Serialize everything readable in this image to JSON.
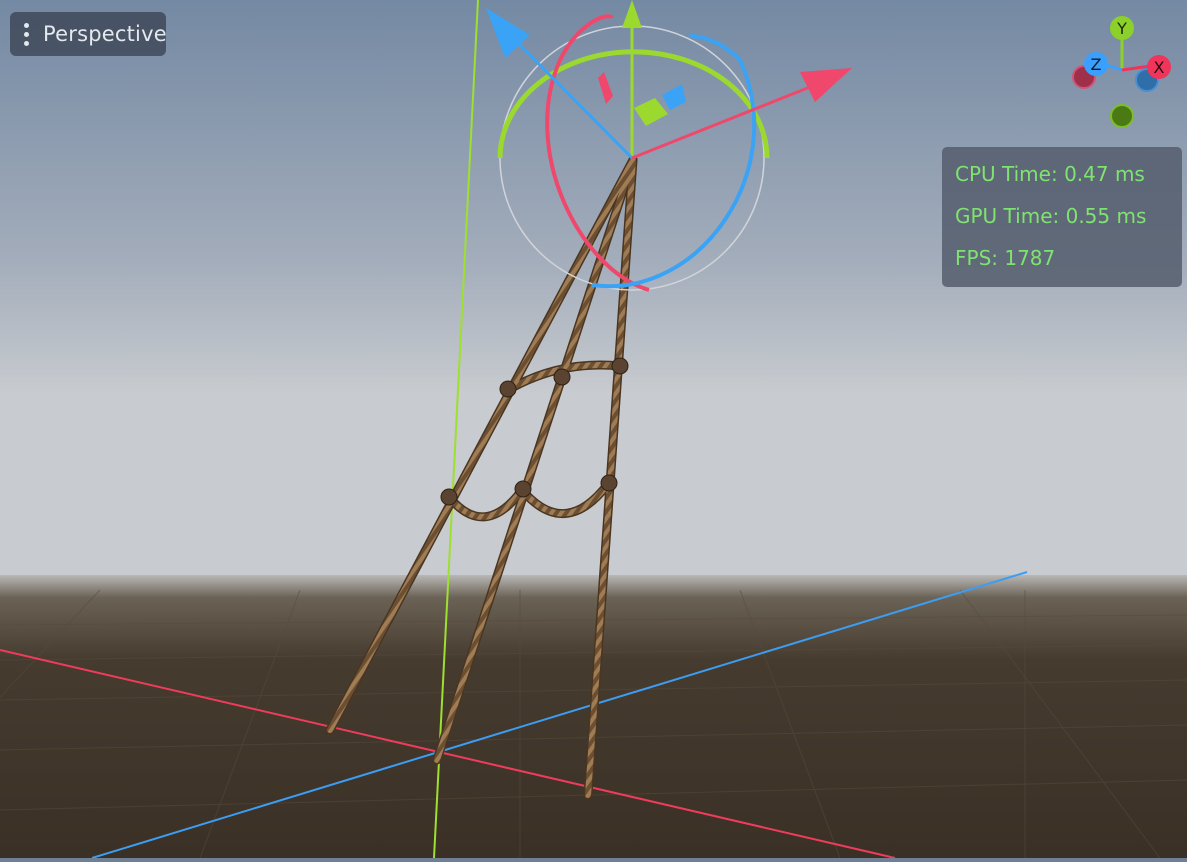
{
  "toolbar": {
    "view_menu_icon": "kebab-menu-icon",
    "view_mode": "Perspective"
  },
  "stats": {
    "cpu_time": "CPU Time: 0.47 ms",
    "gpu_time": "GPU Time: 0.55 ms",
    "fps": "FPS: 1787",
    "text_color": "#7fe36f"
  },
  "axis_gizmo": {
    "labels": {
      "x": "X",
      "y": "Y",
      "z": "Z"
    },
    "colors": {
      "x": "#f0345a",
      "y": "#8bd12a",
      "z": "#3aa0ff"
    }
  },
  "scene": {
    "sky_color_top": "#7c8ea6",
    "sky_color_horizon": "#c4c8ce",
    "ground_color": "#3d3428",
    "object": "rope-net",
    "transform_gizmo_colors": {
      "x": "#f0476c",
      "y": "#9bd92f",
      "z": "#3aa3f5"
    }
  }
}
